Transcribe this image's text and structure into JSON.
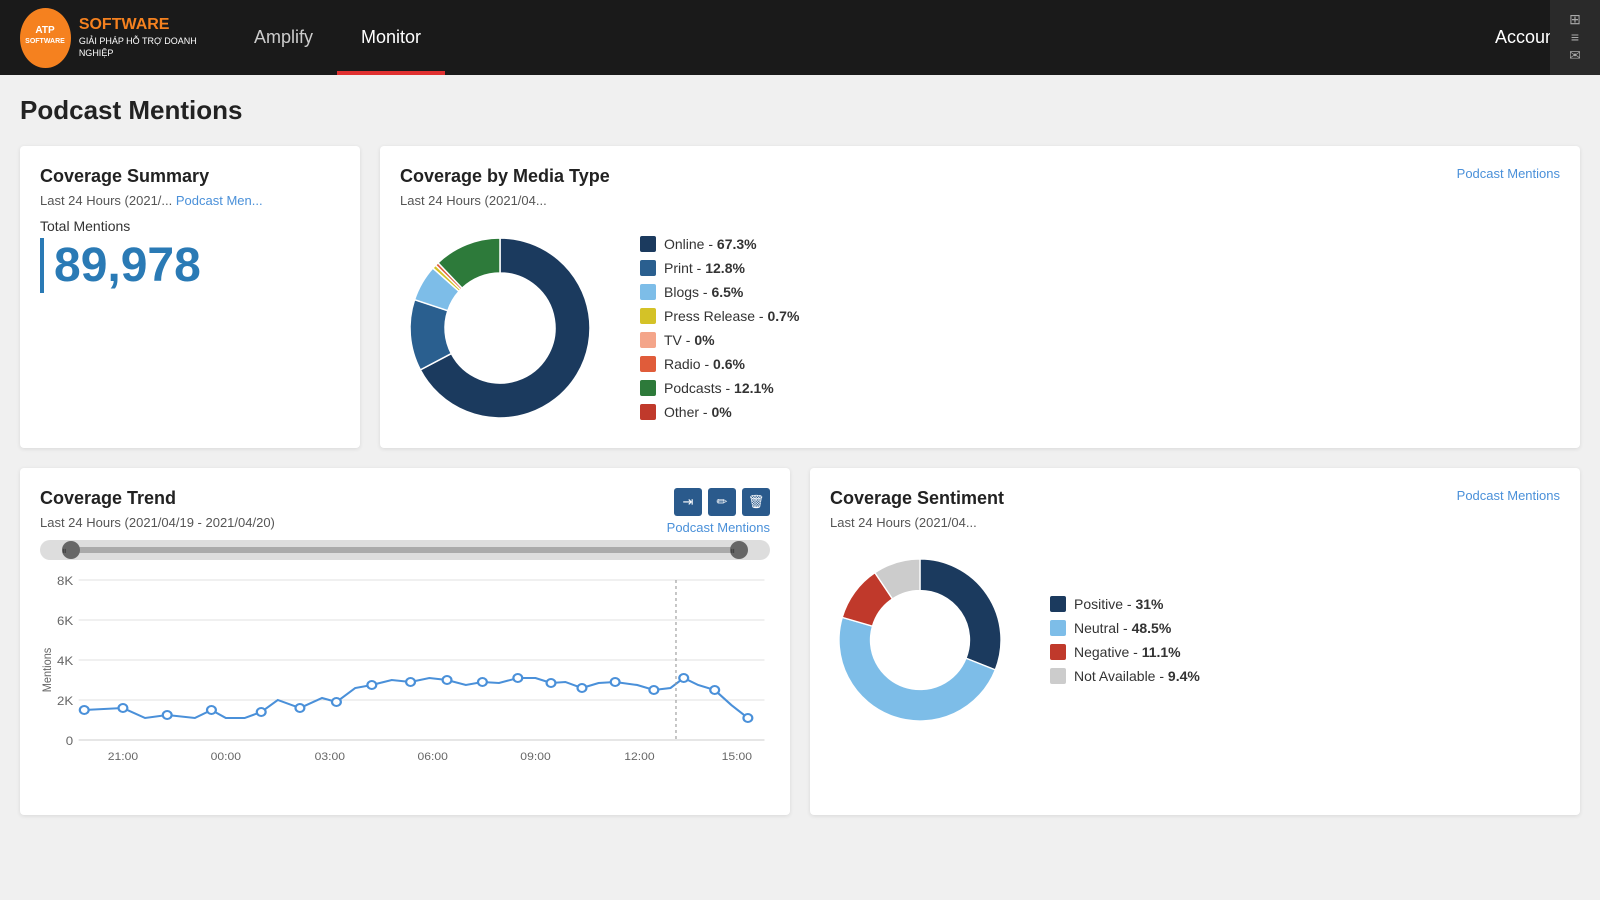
{
  "header": {
    "logo_top": "ATP",
    "logo_sub": "SOFTWARE",
    "logo_tagline": "GIẢI PHÁP HỖ TRỢ DOANH NGHIỆP",
    "nav": [
      {
        "id": "amplify",
        "label": "Amplify",
        "active": false
      },
      {
        "id": "monitor",
        "label": "Monitor",
        "active": true
      }
    ],
    "account_label": "Account"
  },
  "page": {
    "title": "Podcast Mentions"
  },
  "coverage_summary": {
    "title": "Coverage Summary",
    "subtitle_time": "Last 24 Hours (2021/...",
    "subtitle_link": "Podcast Men...",
    "total_label": "Total Mentions",
    "total_value": "89,978"
  },
  "coverage_media": {
    "title": "Coverage by Media Type",
    "subtitle": "Last 24 Hours (2021/04...",
    "link": "Podcast Mentions",
    "segments": [
      {
        "label": "Online",
        "pct": "67.3%",
        "color": "#1b3a5e",
        "value": 67.3
      },
      {
        "label": "Print",
        "pct": "12.8%",
        "color": "#2a5f8f",
        "value": 12.8
      },
      {
        "label": "Blogs",
        "pct": "6.5%",
        "color": "#7dbde8",
        "value": 6.5
      },
      {
        "label": "Press Release",
        "pct": "0.7%",
        "color": "#d4c227",
        "value": 0.7
      },
      {
        "label": "TV",
        "pct": "0%",
        "color": "#f4a58a",
        "value": 0
      },
      {
        "label": "Radio",
        "pct": "0.6%",
        "color": "#e05c3a",
        "value": 0.6
      },
      {
        "label": "Podcasts",
        "pct": "12.1%",
        "color": "#2d7a3a",
        "value": 12.1
      },
      {
        "label": "Other",
        "pct": "0%",
        "color": "#c0392b",
        "value": 0
      }
    ]
  },
  "coverage_trend": {
    "title": "Coverage Trend",
    "subtitle": "Last 24 Hours (2021/04/19 - 2021/04/20)",
    "link": "Podcast Mentions",
    "y_labels": [
      "8K",
      "6K",
      "4K",
      "2K",
      "0"
    ],
    "x_labels": [
      "21:00",
      "00:00",
      "03:00",
      "06:00",
      "09:00",
      "12:00",
      "15:00"
    ],
    "y_axis_label": "Mentions",
    "icons": [
      "export-icon",
      "edit-icon",
      "trash-icon"
    ]
  },
  "coverage_sentiment": {
    "title": "Coverage Sentiment",
    "subtitle": "Last 24 Hours (2021/04...",
    "link": "Podcast Mentions",
    "segments": [
      {
        "label": "Positive",
        "pct": "31%",
        "color": "#1b3a5e",
        "value": 31
      },
      {
        "label": "Neutral",
        "pct": "48.5%",
        "color": "#7dbde8",
        "value": 48.5
      },
      {
        "label": "Negative",
        "pct": "11.1%",
        "color": "#c0392b",
        "value": 11.1
      },
      {
        "label": "Not Available",
        "pct": "9.4%",
        "color": "#cccccc",
        "value": 9.4
      }
    ]
  }
}
